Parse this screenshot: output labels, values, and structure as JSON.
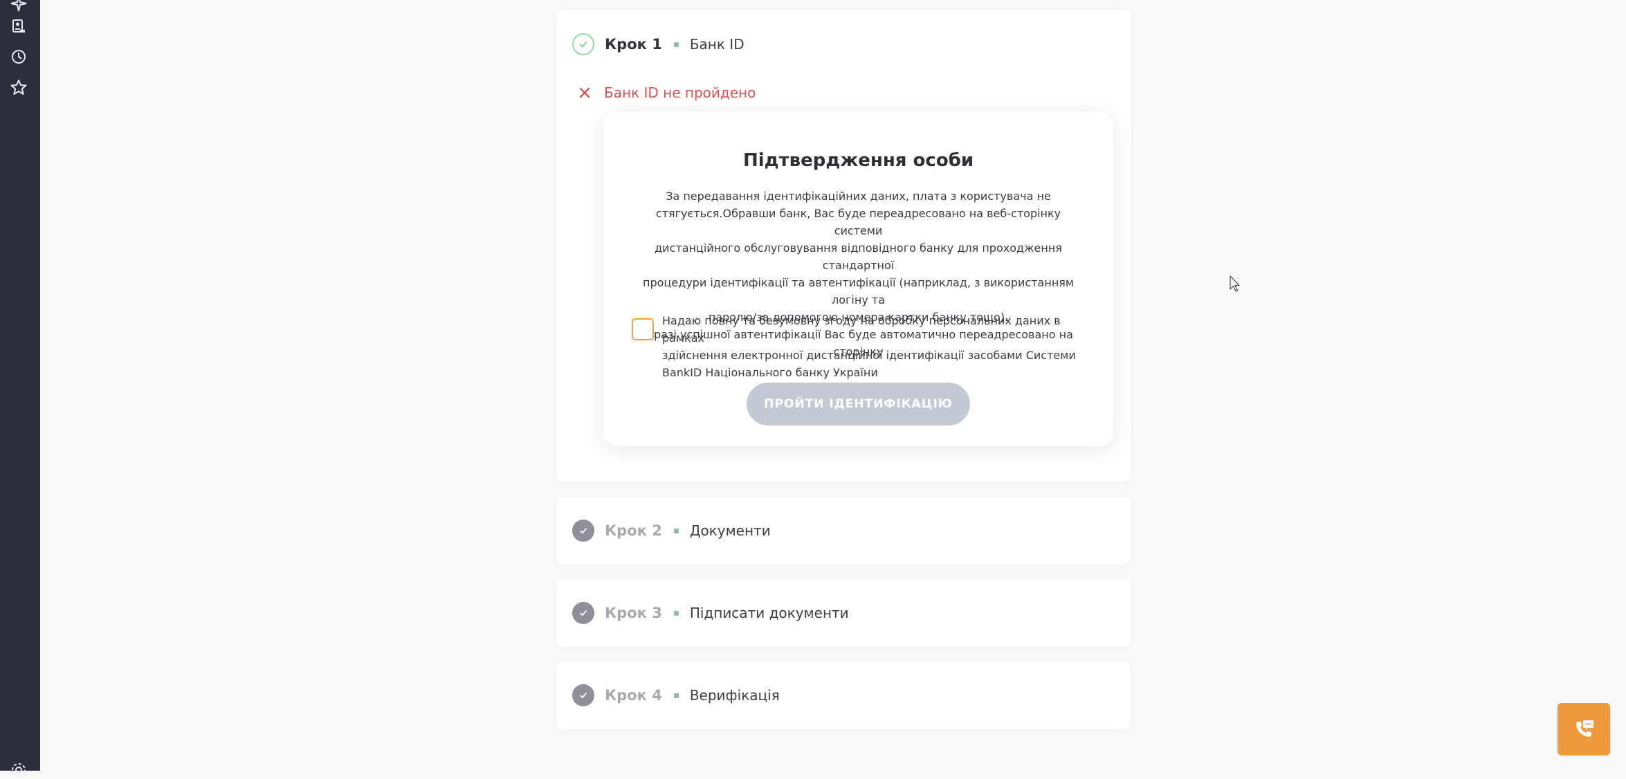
{
  "sidebar": {
    "icons": [
      "sparkle-icon",
      "document-user-icon",
      "clock-icon",
      "star-icon",
      "settings-icon"
    ]
  },
  "steps": [
    {
      "label": "Крок 1",
      "name": "Банк ID",
      "state": "active"
    },
    {
      "label": "Крок 2",
      "name": "Документи",
      "state": "todo"
    },
    {
      "label": "Крок 3",
      "name": "Підписати документи",
      "state": "todo"
    },
    {
      "label": "Крок 4",
      "name": "Верифікація",
      "state": "todo"
    }
  ],
  "bankid": {
    "error_text": "Банк ID не пройдено",
    "modal": {
      "title": "Підтвердження особи",
      "description_lines": [
        "За передавання ідентифікаційних даних, плата з користувача не",
        "стягується.Обравши банк, Вас буде переадресовано на веб-сторінку системи",
        "дистанційного обслуговування відповідного банку для проходження стандартної",
        "процедури ідентифікації та автентифікації (наприклад, з використанням логіну та",
        "паролю/за допомогою номера картки банку тощо).",
        "У разі успішної автентифікації Вас буде автоматично переадресовано на сторінку"
      ],
      "consent_lines": [
        "Надаю повну та безумовну згоду на обробку персональних даних в рамках",
        "здійснення електронної дистанційної ідентифікації засобами Системи",
        "BankID Національного банку України"
      ],
      "consent_checked": false,
      "button_label": "ПРОЙТИ ІДЕНТИФІКАЦІЮ"
    }
  },
  "support": {
    "call_icon": "phone-chat-icon"
  },
  "colors": {
    "sidebar": "#2c2e3c",
    "accent": "#ef9a3c",
    "error": "#e05252",
    "success": "#8fdba2",
    "button_disabled": "#c3cad4"
  }
}
